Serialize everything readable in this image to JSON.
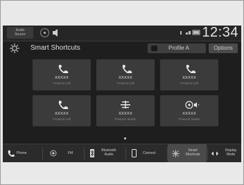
{
  "status": {
    "audio_source_label": "Audio\nSource",
    "clock": "12:34"
  },
  "header": {
    "title": "Smart Shortcuts",
    "profile_label": "Profile A",
    "options_label": "Options"
  },
  "shortcuts": [
    {
      "icon": "phone-icon",
      "name": "XXXXX",
      "type": "Frequent Call"
    },
    {
      "icon": "phone-icon",
      "name": "XXXXX",
      "type": "Frequent Call"
    },
    {
      "icon": "phone-icon",
      "name": "XXXXX",
      "type": "Frequent Call"
    },
    {
      "icon": "phone-icon",
      "name": "XXXXX",
      "type": "Frequent Call"
    },
    {
      "icon": "radio-icon",
      "name": "XXXXX",
      "type": "Frequent Station"
    },
    {
      "icon": "media-icon",
      "name": "XXXXX",
      "type": "Frequent Station"
    }
  ],
  "nav": {
    "phone": "Phone",
    "fm": "FM",
    "bluetooth_audio": "Bluetooth\nAudio",
    "connect": "Connect",
    "smart_shortcuts": "Smart\nShortcuts",
    "display_mode": "Display\nMode"
  },
  "colors": {
    "screen_bg": "#1e1e1e",
    "tile_bg": "#3b3b3b",
    "active_nav_bg": "#4a4a4a"
  }
}
